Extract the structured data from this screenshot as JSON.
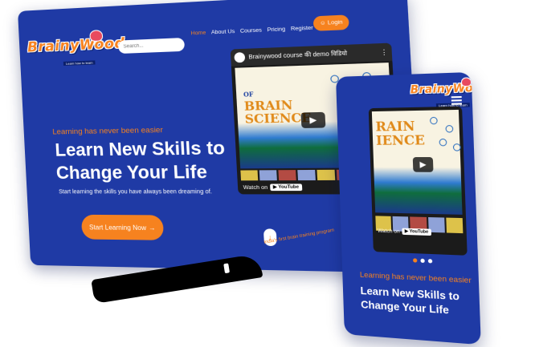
{
  "desktop": {
    "logo": {
      "text": "BrainyWood",
      "tagline": "Learn how to learn"
    },
    "search": {
      "placeholder": "Search..."
    },
    "nav": {
      "items": [
        "Home",
        "About Us",
        "Courses",
        "Pricing",
        "Register"
      ],
      "active": "Home"
    },
    "login_label": "Login",
    "hero": {
      "tagline": "Learning has never been easier",
      "headline_line1": "Learn New Skills to",
      "headline_line2": "Change Your Life",
      "subtitle": "Start learning the skills you have always been dreaming of.",
      "cta_label": "Start Learning Now"
    },
    "video": {
      "title": "Brainywood course की demo विडियो",
      "thumb_line1": "OF",
      "thumb_line2": "BRAIN",
      "thumb_line3": "SCIENCE",
      "watch_on": "Watch on",
      "platform": "YouTube"
    }
  },
  "phone": {
    "logo": {
      "text": "BrainyWood",
      "tagline": "Learn how to learn"
    },
    "video": {
      "thumb_line1": "RAIN",
      "thumb_line2": "IENCE",
      "watch_on": "Watch on",
      "platform": "YouTube"
    },
    "hero": {
      "tagline": "Learning has never been easier",
      "headline_line1": "Learn New Skills to",
      "headline_line2": "Change Your Life"
    }
  },
  "floating_caption": "India's first brain training program",
  "icons": {
    "user": "user-icon",
    "arrow_right": "arrow-right-icon",
    "arrow_down": "arrow-down-icon",
    "play": "play-icon",
    "menu": "hamburger-icon",
    "youtube": "youtube-icon"
  },
  "colors": {
    "brand_blue": "#1f3aa5",
    "accent_orange": "#f6821f",
    "text_white": "#ffffff"
  }
}
